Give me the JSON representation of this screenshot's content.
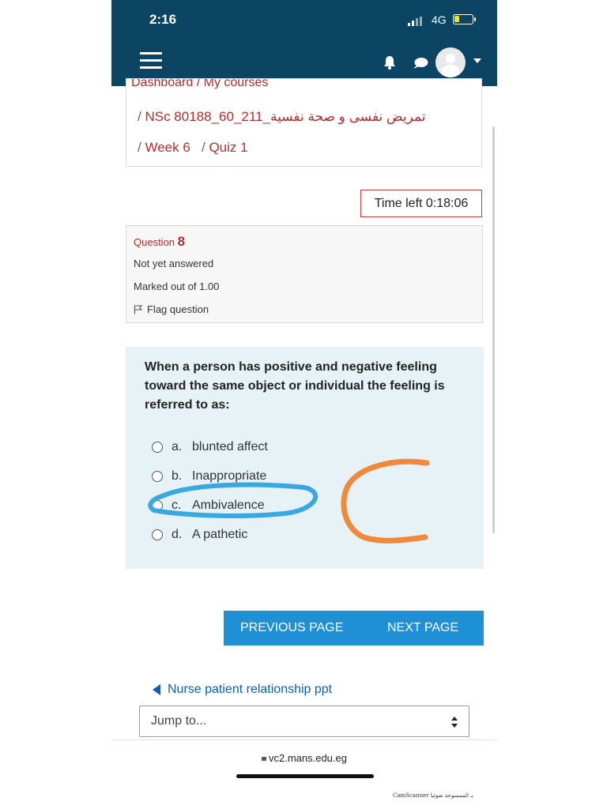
{
  "status_bar": {
    "time": "2:16",
    "network": "4G"
  },
  "header": {
    "colors": {
      "background": "#0c4563",
      "battery": "#f2e31a"
    },
    "icons": [
      "menu-icon",
      "bell-icon",
      "chat-bubble-icon",
      "avatar",
      "chevron-down-icon"
    ]
  },
  "breadcrumb": {
    "partial_top": "Dashboard / My courses",
    "course": "تمريض نفسى و صحة نفسية_NSc 80188_60_211",
    "week": "Week 6",
    "quiz": "Quiz 1",
    "separator": "/"
  },
  "timer": {
    "text": "Time left 0:18:06"
  },
  "question_info": {
    "label": "Question",
    "number": "8",
    "state": "Not yet answered",
    "marks": "Marked out of 1.00",
    "flag": "Flag question"
  },
  "question": {
    "text": "When a person has positive and negative feeling toward the same object or individual the feeling is referred to as:",
    "options": [
      {
        "letter": "a.",
        "text": "blunted affect"
      },
      {
        "letter": "b.",
        "text": "Inappropriate"
      },
      {
        "letter": "c.",
        "text": "Ambivalence"
      },
      {
        "letter": "d.",
        "text": "A pathetic"
      }
    ],
    "annotations": {
      "circled_option": "c.",
      "handwritten_answer": "C",
      "circle_color": "#3aa8e0",
      "letter_color": "#f08a3a"
    }
  },
  "navigation": {
    "previous": "PREVIOUS PAGE",
    "next": "NEXT PAGE",
    "color": "#1e90d6"
  },
  "prev_activity": {
    "text": "Nurse patient relationship ppt"
  },
  "jump": {
    "label": "Jump to..."
  },
  "browser": {
    "url": "vc2.mans.edu.eg"
  },
  "watermark": {
    "text": "CamScanner بـ الممسوحة ضوئيا"
  }
}
